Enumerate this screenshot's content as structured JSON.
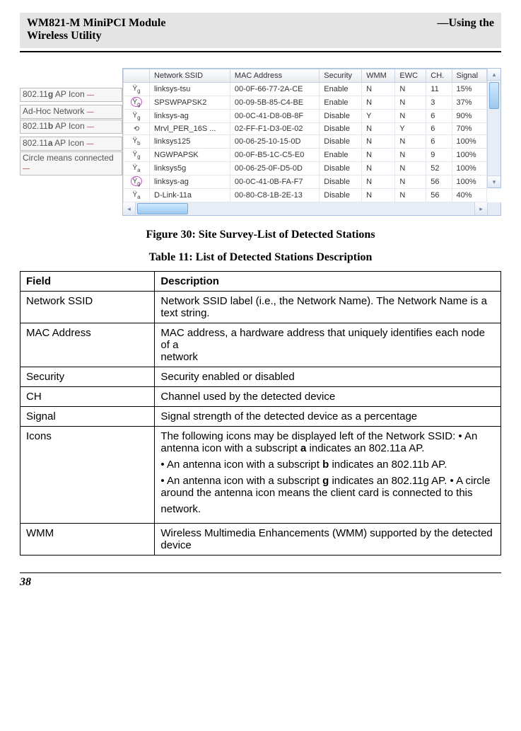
{
  "header": {
    "left_line1": "WM821-M MiniPCI Module",
    "left_line2": "Wireless Utility",
    "right": "—Using the"
  },
  "screenshot": {
    "labels": [
      {
        "prefix_plain": "802.11",
        "prefix_bold": "g",
        "suffix": " AP Icon"
      },
      {
        "prefix_plain": "Ad-Hoc Network",
        "prefix_bold": "",
        "suffix": ""
      },
      {
        "prefix_plain": "802.11",
        "prefix_bold": "b",
        "suffix": " AP Icon"
      },
      {
        "prefix_plain": "802.11",
        "prefix_bold": "a",
        "suffix": " AP Icon"
      },
      {
        "prefix_plain": "Circle means connected",
        "prefix_bold": "",
        "suffix": ""
      }
    ],
    "columns": [
      "Network SSID",
      "MAC Address",
      "Security",
      "WMM",
      "EWC",
      "CH.",
      "Signal"
    ],
    "rows": [
      {
        "icon": "g",
        "circled": false,
        "ssid": "linksys-tsu",
        "mac": "00-0F-66-77-2A-CE",
        "sec": "Enable",
        "wmm": "N",
        "ewc": "N",
        "ch": "11",
        "sig": "15%"
      },
      {
        "icon": "g",
        "circled": true,
        "ssid": "SPSWPAPSK2",
        "mac": "00-09-5B-85-C4-BE",
        "sec": "Enable",
        "wmm": "N",
        "ewc": "N",
        "ch": "3",
        "sig": "37%"
      },
      {
        "icon": "g",
        "circled": false,
        "ssid": "linksys-ag",
        "mac": "00-0C-41-D8-0B-8F",
        "sec": "Disable",
        "wmm": "Y",
        "ewc": "N",
        "ch": "6",
        "sig": "90%"
      },
      {
        "icon": "adhoc",
        "circled": false,
        "ssid": "Mrvl_PER_16S ...",
        "mac": "02-FF-F1-D3-0E-02",
        "sec": "Disable",
        "wmm": "N",
        "ewc": "Y",
        "ch": "6",
        "sig": "70%"
      },
      {
        "icon": "b",
        "circled": false,
        "ssid": "linksys125",
        "mac": "00-06-25-10-15-0D",
        "sec": "Disable",
        "wmm": "N",
        "ewc": "N",
        "ch": "6",
        "sig": "100%"
      },
      {
        "icon": "g",
        "circled": false,
        "ssid": "NGWPAPSK",
        "mac": "00-0F-B5-1C-C5-E0",
        "sec": "Enable",
        "wmm": "N",
        "ewc": "N",
        "ch": "9",
        "sig": "100%"
      },
      {
        "icon": "a",
        "circled": false,
        "ssid": "linksys5g",
        "mac": "00-06-25-0F-D5-0D",
        "sec": "Disable",
        "wmm": "N",
        "ewc": "N",
        "ch": "52",
        "sig": "100%"
      },
      {
        "icon": "g",
        "circled": true,
        "ssid": "linksys-ag",
        "mac": "00-0C-41-0B-FA-F7",
        "sec": "Disable",
        "wmm": "N",
        "ewc": "N",
        "ch": "56",
        "sig": "100%"
      },
      {
        "icon": "a",
        "circled": false,
        "ssid": "D-Link-11a",
        "mac": "00-80-C8-1B-2E-13",
        "sec": "Disable",
        "wmm": "N",
        "ewc": "N",
        "ch": "56",
        "sig": "40%"
      }
    ]
  },
  "figure_caption": "Figure 30: Site Survey-List of Detected Stations",
  "table_caption": "Table 11: List of Detected Stations Description",
  "desc_table": {
    "headers": {
      "field": "Field",
      "description": "Description"
    },
    "rows": [
      {
        "field": "Network SSID",
        "desc": "Network SSID label (i.e., the Network Name). The Network Name is a text string."
      },
      {
        "field": "MAC Address",
        "desc": "MAC address, a hardware address that uniquely identifies each node of a\nnetwork"
      },
      {
        "field": "Security",
        "desc": "Security enabled or disabled"
      },
      {
        "field": "CH",
        "desc": "Channel used by the detected device"
      },
      {
        "field": "Signal",
        "desc": "Signal strength of the detected device as a percentage"
      },
      {
        "field": "Icons",
        "desc_parts": [
          "The following icons may be displayed left of the Network SSID: • An antenna icon with a subscript <b>a</b> indicates an 802.11a AP.",
          "• An antenna icon with a subscript <b>b</b> indicates an 802.11b AP.",
          "• An antenna icon with a subscript <b>g</b> indicates an 802.11g AP. • A circle around the antenna icon means the client card is connected to this",
          "network."
        ]
      },
      {
        "field": "WMM",
        "desc": "Wireless Multimedia Enhancements (WMM) supported by the detected device"
      }
    ]
  },
  "page_number": "38"
}
